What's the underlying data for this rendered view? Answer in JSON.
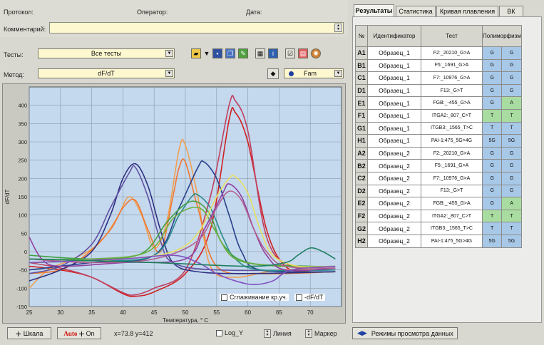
{
  "header": {
    "protocol_label": "Протокол:",
    "operator_label": "Оператор:",
    "date_label": "Дата:",
    "comment_label": "Комментарий:"
  },
  "controls": {
    "tests_label": "Тесты:",
    "tests_value": "Все тесты",
    "method_label": "Метод:",
    "method_value": "dF/dT",
    "channel_value": "Fam"
  },
  "chart_data": {
    "type": "line",
    "xlabel": "Температура, ° C",
    "ylabel": "dF/dT",
    "xlim": [
      25,
      75
    ],
    "ylim": [
      -150,
      450
    ],
    "x_ticks": [
      25,
      30,
      35,
      40,
      45,
      50,
      55,
      60,
      65,
      70
    ],
    "y_ticks": [
      -150,
      -100,
      -50,
      0,
      50,
      100,
      150,
      200,
      250,
      300,
      350,
      400
    ],
    "grid": true,
    "series": [
      {
        "color": "#d02020",
        "points": [
          [
            25,
            -40
          ],
          [
            30,
            -50
          ],
          [
            35,
            -70
          ],
          [
            40,
            -115
          ],
          [
            42,
            -122
          ],
          [
            45,
            -110
          ],
          [
            50,
            -60
          ],
          [
            54,
            60
          ],
          [
            57,
            360
          ],
          [
            58,
            380
          ],
          [
            60,
            300
          ],
          [
            63,
            60
          ],
          [
            66,
            -40
          ],
          [
            70,
            -55
          ],
          [
            74,
            -55
          ]
        ]
      },
      {
        "color": "#c04060",
        "points": [
          [
            25,
            -30
          ],
          [
            30,
            -45
          ],
          [
            35,
            -70
          ],
          [
            40,
            -112
          ],
          [
            42,
            -118
          ],
          [
            45,
            -100
          ],
          [
            50,
            -50
          ],
          [
            54,
            150
          ],
          [
            57,
            400
          ],
          [
            58,
            412
          ],
          [
            60,
            330
          ],
          [
            63,
            40
          ],
          [
            67,
            -40
          ],
          [
            74,
            -50
          ]
        ]
      },
      {
        "color": "#f0a050",
        "points": [
          [
            25,
            -100
          ],
          [
            28,
            -50
          ],
          [
            32,
            -20
          ],
          [
            36,
            20
          ],
          [
            39,
            90
          ],
          [
            41,
            150
          ],
          [
            43,
            100
          ],
          [
            45,
            10
          ],
          [
            47,
            80
          ],
          [
            49,
            280
          ],
          [
            50,
            290
          ],
          [
            52,
            150
          ],
          [
            54,
            -40
          ],
          [
            58,
            -70
          ],
          [
            65,
            -50
          ],
          [
            74,
            -50
          ]
        ]
      },
      {
        "color": "#f07830",
        "points": [
          [
            25,
            -60
          ],
          [
            30,
            -50
          ],
          [
            34,
            -10
          ],
          [
            38,
            60
          ],
          [
            40,
            120
          ],
          [
            42,
            140
          ],
          [
            44,
            60
          ],
          [
            46,
            0
          ],
          [
            48,
            150
          ],
          [
            49,
            230
          ],
          [
            50,
            245
          ],
          [
            52,
            120
          ],
          [
            55,
            -40
          ],
          [
            62,
            -60
          ],
          [
            74,
            -55
          ]
        ]
      },
      {
        "color": "#303080",
        "points": [
          [
            25,
            -80
          ],
          [
            30,
            -50
          ],
          [
            35,
            0
          ],
          [
            38,
            100
          ],
          [
            40,
            200
          ],
          [
            42,
            240
          ],
          [
            44,
            180
          ],
          [
            46,
            60
          ],
          [
            48,
            -30
          ],
          [
            52,
            -55
          ],
          [
            60,
            -60
          ],
          [
            74,
            -55
          ]
        ]
      },
      {
        "color": "#6050a0",
        "points": [
          [
            25,
            -60
          ],
          [
            30,
            -40
          ],
          [
            35,
            20
          ],
          [
            38,
            120
          ],
          [
            41,
            215
          ],
          [
            42,
            230
          ],
          [
            44,
            150
          ],
          [
            46,
            30
          ],
          [
            48,
            -30
          ],
          [
            55,
            -50
          ],
          [
            74,
            -50
          ]
        ]
      },
      {
        "color": "#28408a",
        "points": [
          [
            25,
            -50
          ],
          [
            35,
            -30
          ],
          [
            45,
            -10
          ],
          [
            49,
            120
          ],
          [
            52,
            230
          ],
          [
            53,
            245
          ],
          [
            55,
            200
          ],
          [
            57,
            100
          ],
          [
            59,
            0
          ],
          [
            62,
            -50
          ],
          [
            74,
            -55
          ]
        ]
      },
      {
        "color": "#2a8a8a",
        "points": [
          [
            25,
            -30
          ],
          [
            35,
            -25
          ],
          [
            45,
            -10
          ],
          [
            49,
            100
          ],
          [
            51,
            150
          ],
          [
            52,
            155
          ],
          [
            54,
            120
          ],
          [
            56,
            40
          ],
          [
            58,
            -20
          ],
          [
            62,
            -50
          ],
          [
            74,
            -50
          ]
        ]
      },
      {
        "color": "#40a040",
        "points": [
          [
            25,
            -10
          ],
          [
            35,
            -20
          ],
          [
            43,
            -5
          ],
          [
            47,
            80
          ],
          [
            50,
            130
          ],
          [
            52,
            135
          ],
          [
            54,
            100
          ],
          [
            56,
            20
          ],
          [
            60,
            -30
          ],
          [
            70,
            -40
          ],
          [
            74,
            -40
          ]
        ]
      },
      {
        "color": "#70b040",
        "points": [
          [
            25,
            -20
          ],
          [
            35,
            -20
          ],
          [
            44,
            0
          ],
          [
            48,
            90
          ],
          [
            51,
            120
          ],
          [
            53,
            110
          ],
          [
            55,
            50
          ],
          [
            58,
            -20
          ],
          [
            65,
            -40
          ],
          [
            74,
            -40
          ]
        ]
      },
      {
        "color": "#e8e060",
        "points": [
          [
            25,
            -30
          ],
          [
            40,
            -20
          ],
          [
            48,
            0
          ],
          [
            52,
            50
          ],
          [
            55,
            150
          ],
          [
            57,
            200
          ],
          [
            58,
            205
          ],
          [
            60,
            160
          ],
          [
            62,
            60
          ],
          [
            64,
            -10
          ],
          [
            68,
            -40
          ],
          [
            74,
            -40
          ]
        ]
      },
      {
        "color": "#9040a0",
        "points": [
          [
            25,
            40
          ],
          [
            27,
            -20
          ],
          [
            30,
            -40
          ],
          [
            40,
            -30
          ],
          [
            50,
            -20
          ],
          [
            53,
            60
          ],
          [
            56,
            160
          ],
          [
            57,
            185
          ],
          [
            59,
            150
          ],
          [
            61,
            60
          ],
          [
            63,
            -10
          ],
          [
            66,
            -50
          ],
          [
            74,
            -45
          ]
        ]
      },
      {
        "color": "#b06090",
        "points": [
          [
            25,
            -20
          ],
          [
            35,
            -30
          ],
          [
            45,
            -20
          ],
          [
            52,
            30
          ],
          [
            55,
            120
          ],
          [
            57,
            165
          ],
          [
            59,
            140
          ],
          [
            61,
            60
          ],
          [
            63,
            0
          ],
          [
            66,
            -40
          ],
          [
            74,
            -45
          ]
        ]
      },
      {
        "color": "#8050c0",
        "points": [
          [
            25,
            -30
          ],
          [
            40,
            -20
          ],
          [
            48,
            -10
          ],
          [
            52,
            -30
          ],
          [
            55,
            -60
          ],
          [
            58,
            -80
          ],
          [
            61,
            -90
          ],
          [
            64,
            -80
          ],
          [
            67,
            -50
          ],
          [
            74,
            -40
          ]
        ]
      },
      {
        "color": "#208060",
        "points": [
          [
            25,
            -20
          ],
          [
            45,
            -30
          ],
          [
            60,
            -40
          ],
          [
            66,
            -30
          ],
          [
            68,
            -10
          ],
          [
            70,
            10
          ],
          [
            72,
            0
          ],
          [
            74,
            -20
          ]
        ]
      }
    ]
  },
  "chart_options": {
    "smoothing_label": "Сглаживание кр.уч.",
    "neg_df_label": "-dF/dT"
  },
  "bottom_bar": {
    "scale_label": "Шкала",
    "auto_label": "Auto",
    "on_label": "On",
    "coords": "x=73.8 y=412",
    "logy_label": "Log_Y",
    "line_label": "Линия",
    "marker_label": "Маркер"
  },
  "tabs": [
    "Результаты",
    "Статистика",
    "Кривая плавления",
    "ВК"
  ],
  "results": {
    "headers": [
      "№",
      "Идентификатор",
      "Тест",
      "Полиморфизм"
    ],
    "rows": [
      {
        "well": "A1",
        "id": "Образец_1",
        "test": "F2:_20210_G>A",
        "p1": "G",
        "p2": "G",
        "c1": "#a8c8e8",
        "c2": "#a8c8e8"
      },
      {
        "well": "B1",
        "id": "Образец_1",
        "test": "F5:_1691_G>A",
        "p1": "G",
        "p2": "G",
        "c1": "#a8c8e8",
        "c2": "#a8c8e8"
      },
      {
        "well": "C1",
        "id": "Образец_1",
        "test": "F7:_10976_G>A",
        "p1": "G",
        "p2": "G",
        "c1": "#a8c8e8",
        "c2": "#a8c8e8"
      },
      {
        "well": "D1",
        "id": "Образец_1",
        "test": "F13:_G>T",
        "p1": "G",
        "p2": "G",
        "c1": "#a8c8e8",
        "c2": "#a8c8e8"
      },
      {
        "well": "E1",
        "id": "Образец_1",
        "test": "FGB:_-455_G>A",
        "p1": "G",
        "p2": "A",
        "c1": "#a8c8e8",
        "c2": "#a8dca0"
      },
      {
        "well": "F1",
        "id": "Образец_1",
        "test": "ITGA2:_807_C>T",
        "p1": "T",
        "p2": "T",
        "c1": "#a8dca0",
        "c2": "#a8dca0"
      },
      {
        "well": "G1",
        "id": "Образец_1",
        "test": "ITGB3:_1565_T>C",
        "p1": "T",
        "p2": "T",
        "c1": "#a8c8e8",
        "c2": "#a8c8e8"
      },
      {
        "well": "H1",
        "id": "Образец_1",
        "test": "PAI-1:475_5G>4G",
        "p1": "5G",
        "p2": "5G",
        "c1": "#a8c8e8",
        "c2": "#a8c8e8"
      },
      {
        "well": "A2",
        "id": "Образец_2",
        "test": "F2:_20210_G>A",
        "p1": "G",
        "p2": "G",
        "c1": "#a8c8e8",
        "c2": "#a8c8e8"
      },
      {
        "well": "B2",
        "id": "Образец_2",
        "test": "F5:_1691_G>A",
        "p1": "G",
        "p2": "G",
        "c1": "#a8c8e8",
        "c2": "#a8c8e8"
      },
      {
        "well": "C2",
        "id": "Образец_2",
        "test": "F7:_10976_G>A",
        "p1": "G",
        "p2": "G",
        "c1": "#a8c8e8",
        "c2": "#a8c8e8"
      },
      {
        "well": "D2",
        "id": "Образец_2",
        "test": "F13:_G>T",
        "p1": "G",
        "p2": "G",
        "c1": "#a8c8e8",
        "c2": "#a8c8e8"
      },
      {
        "well": "E2",
        "id": "Образец_2",
        "test": "FGB:_-455_G>A",
        "p1": "G",
        "p2": "A",
        "c1": "#a8c8e8",
        "c2": "#a8dca0"
      },
      {
        "well": "F2",
        "id": "Образец_2",
        "test": "ITGA2:_807_C>T",
        "p1": "T",
        "p2": "T",
        "c1": "#a8dca0",
        "c2": "#a8dca0"
      },
      {
        "well": "G2",
        "id": "Образец_2",
        "test": "ITGB3:_1565_T>C",
        "p1": "T",
        "p2": "T",
        "c1": "#a8c8e8",
        "c2": "#a8c8e8"
      },
      {
        "well": "H2",
        "id": "Образец_2",
        "test": "PAI-1:475_5G>4G",
        "p1": "5G",
        "p2": "5G",
        "c1": "#a8c8e8",
        "c2": "#a8c8e8"
      }
    ]
  },
  "view_modes_label": "Режимы просмотра данных"
}
